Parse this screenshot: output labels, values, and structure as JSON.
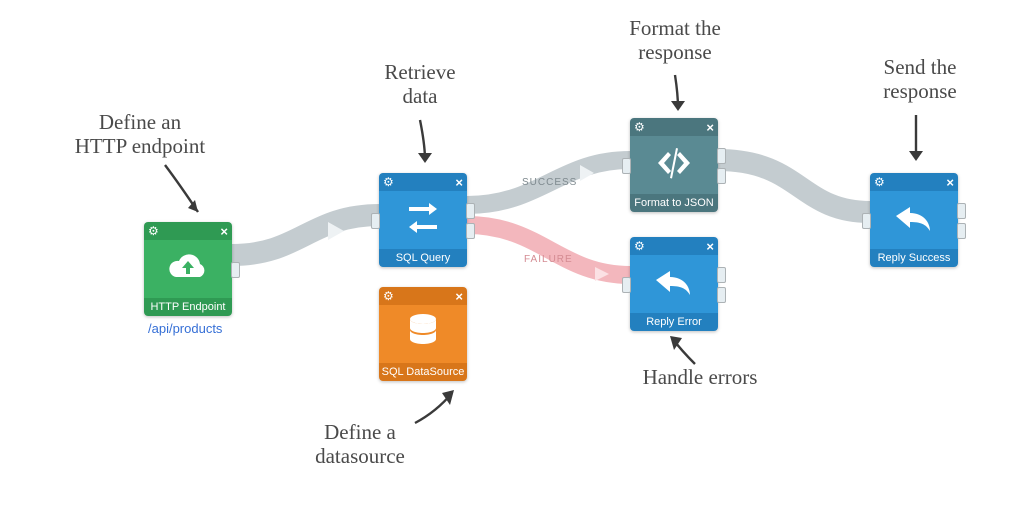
{
  "nodes": {
    "http": {
      "title": "HTTP Endpoint",
      "sub": "/api/products",
      "icon": "cloud-download-icon",
      "fill": "#3bb163",
      "head": "#2f9a53"
    },
    "sql": {
      "title": "SQL Query",
      "icon": "transfer-icon",
      "fill": "#2f96d8",
      "head": "#2380bf"
    },
    "ds": {
      "title": "SQL DataSource",
      "icon": "database-icon",
      "fill": "#ef8a28",
      "head": "#d8761a"
    },
    "fmt": {
      "title": "Format to JSON",
      "icon": "code-icon",
      "fill": "#5a8a93",
      "head": "#4b767e"
    },
    "err": {
      "title": "Reply Error",
      "icon": "reply-icon",
      "fill": "#2f96d8",
      "head": "#2380bf"
    },
    "ok": {
      "title": "Reply Success",
      "icon": "reply-icon",
      "fill": "#2f96d8",
      "head": "#2380bf"
    }
  },
  "edges": {
    "success": "SUCCESS",
    "failure": "FAILURE"
  },
  "annotations": {
    "http": "Define an\nHTTP endpoint",
    "sql": "Retrieve\ndata",
    "ds": "Define a\ndatasource",
    "fmt": "Format the\nresponse",
    "err": "Handle errors",
    "ok": "Send the\nresponse"
  },
  "colors": {
    "flow": "#c4ccd0",
    "failure": "#f3b7bd"
  }
}
